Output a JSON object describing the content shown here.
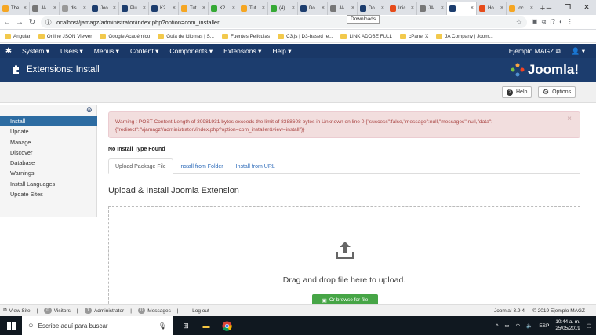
{
  "browser": {
    "tabs": [
      {
        "label": "The",
        "color": "#f5a623"
      },
      {
        "label": "JA",
        "color": "#777777"
      },
      {
        "label": "dis",
        "color": "#999999"
      },
      {
        "label": "Joo",
        "color": "#1c3d6e"
      },
      {
        "label": "Plu",
        "color": "#1c3d6e"
      },
      {
        "label": "K2",
        "color": "#1c3d6e"
      },
      {
        "label": "Tut",
        "color": "#f5a623"
      },
      {
        "label": "K2",
        "color": "#35a935"
      },
      {
        "label": "Tut",
        "color": "#f5a623"
      },
      {
        "label": "(4)",
        "color": "#35a935"
      },
      {
        "label": "Do",
        "color": "#1c3d6e"
      },
      {
        "label": "JA",
        "color": "#777777"
      },
      {
        "label": "Do",
        "color": "#1c3d6e"
      },
      {
        "label": "Inic",
        "color": "#e64a19"
      },
      {
        "label": "JA",
        "color": "#777777"
      },
      {
        "label": "",
        "color": "#1c3d6e"
      },
      {
        "label": "Ho",
        "color": "#e64a19"
      },
      {
        "label": "loc",
        "color": "#f5a623"
      }
    ],
    "url": "localhost/jamagz/administrator/index.php?option=com_installer",
    "tooltip": "Downloads",
    "bookmarks": [
      "Angular",
      "Online JSON Viewer",
      "Google Académico",
      "Guía de Idiomas | S...",
      "Fuentes Películas",
      "C3.js | D3-based re...",
      "LINK ADOBE FULL",
      "cPanel X",
      "JA Company | Joom..."
    ]
  },
  "joomla": {
    "nav": {
      "menu": [
        "System ▾",
        "Users ▾",
        "Menus ▾",
        "Content ▾",
        "Components ▾",
        "Extensions ▾",
        "Help ▾"
      ],
      "site_link": "Ejemplo MAGZ ⧉",
      "user": "▾"
    },
    "header": {
      "title": "Extensions: Install",
      "brand": "Joomla!"
    },
    "toolbar": {
      "help": "Help",
      "options": "Options"
    },
    "sidebar": {
      "items": [
        "Install",
        "Update",
        "Manage",
        "Discover",
        "Database",
        "Warnings",
        "Install Languages",
        "Update Sites"
      ]
    },
    "alert": {
      "line1": "Warning : POST Content-Length of 30981931 bytes exceeds the limit of 8388608 bytes in Unknown on line 0 {\"success\":false,\"message\":null,\"messages\":null,\"data\":",
      "line2": "{\"redirect\":\"\\/jamagz\\/administrator\\/index.php?option=com_installer&view=install\"}}"
    },
    "no_install_type": "No Install Type Found",
    "tabs": [
      "Upload Package File",
      "Install from Folder",
      "Install from URL"
    ],
    "section_title": "Upload & Install Joomla Extension",
    "drop_message": "Drag and drop file here to upload.",
    "browse_button": "Or browse for file",
    "status": {
      "view_site": "View Site",
      "visitors_count": "0",
      "visitors": "Visitors",
      "admin_count": "1",
      "admin": "Administrator",
      "messages_count": "0",
      "messages": "Messages",
      "logout": "Log out",
      "copyright": "Joomla! 3.9.4 — © 2019 Ejemplo MAGZ"
    }
  },
  "taskbar": {
    "search_placeholder": "Escribe aquí para buscar",
    "lang": "ESP",
    "time": "10:44 a. m.",
    "date": "25/05/2019"
  }
}
